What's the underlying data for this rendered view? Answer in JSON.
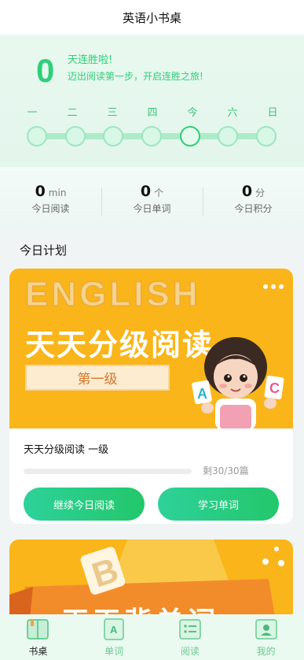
{
  "header": {
    "title": "英语小书桌"
  },
  "streak": {
    "count": "0",
    "title": "天连胜啦!",
    "subtitle": "迈出阅读第一步，开启连胜之旅!",
    "days": [
      "一",
      "二",
      "三",
      "四",
      "今",
      "六",
      "日"
    ],
    "today_index": 4
  },
  "stats": [
    {
      "value": "0",
      "unit": "min",
      "label": "今日阅读"
    },
    {
      "value": "0",
      "unit": "个",
      "label": "今日单词"
    },
    {
      "value": "0",
      "unit": "分",
      "label": "今日积分"
    }
  ],
  "plan": {
    "title": "今日计划",
    "card": {
      "banner_english": "ENGLISH",
      "banner_title": "天天分级阅读",
      "level_badge": "第一级",
      "card_letter_a": "A",
      "card_letter_c": "C",
      "book_name": "天天分级阅读 一级",
      "progress_text": "剩30/30篇",
      "progress_fraction": 0,
      "continue_label": "继续今日阅读",
      "words_label": "学习单词"
    },
    "card2": {
      "banner_title": "天天背单词"
    }
  },
  "tabbar": {
    "items": [
      {
        "label": "书桌",
        "icon": "book-icon",
        "active": true
      },
      {
        "label": "单词",
        "icon": "word-card-icon",
        "active": false
      },
      {
        "label": "阅读",
        "icon": "reading-list-icon",
        "active": false
      },
      {
        "label": "我的",
        "icon": "profile-icon",
        "active": false
      }
    ]
  },
  "colors": {
    "accent": "#2fcf78",
    "banner": "#f9b51a"
  }
}
